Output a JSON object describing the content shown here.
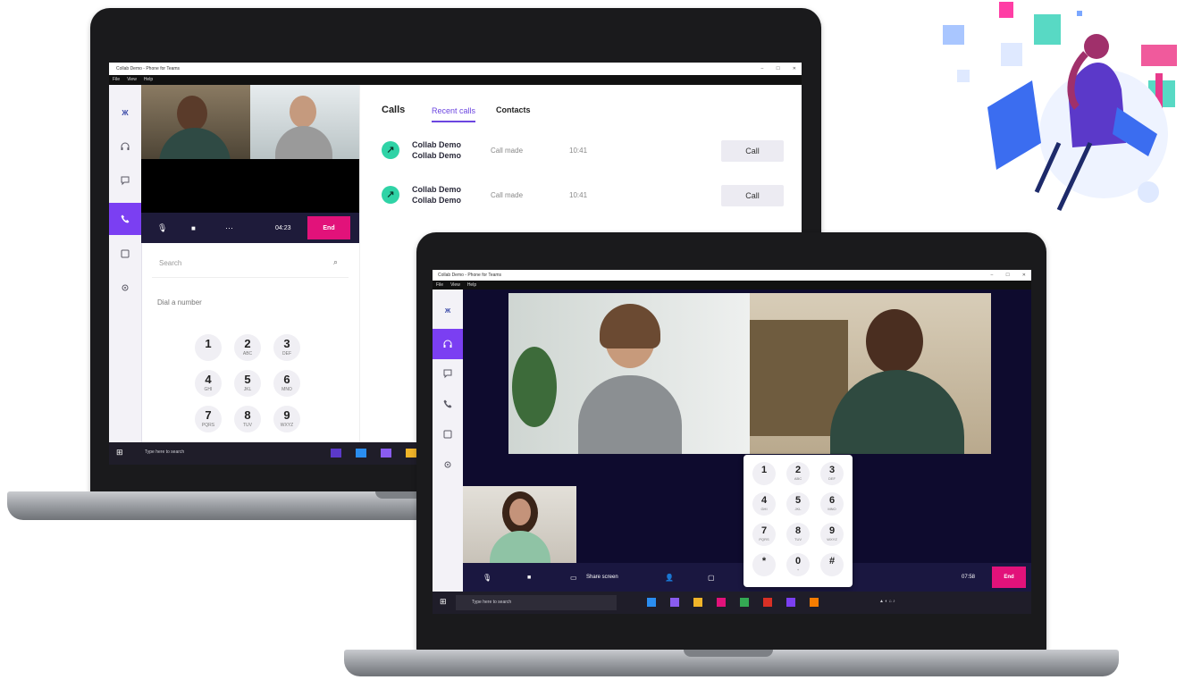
{
  "left_app": {
    "window_title": "Collab Demo - Phone for Teams",
    "menu": [
      "File",
      "View",
      "Help"
    ],
    "call": {
      "timer": "04:23",
      "end_label": "End"
    },
    "search_placeholder": "Search",
    "dial_placeholder": "Dial a number",
    "keypad": [
      {
        "digit": "1",
        "letters": ""
      },
      {
        "digit": "2",
        "letters": "ABC"
      },
      {
        "digit": "3",
        "letters": "DEF"
      },
      {
        "digit": "4",
        "letters": "GHI"
      },
      {
        "digit": "5",
        "letters": "JKL"
      },
      {
        "digit": "6",
        "letters": "MNO"
      },
      {
        "digit": "7",
        "letters": "PQRS"
      },
      {
        "digit": "8",
        "letters": "TUV"
      },
      {
        "digit": "9",
        "letters": "WXYZ"
      }
    ],
    "tabs": {
      "calls": "Calls",
      "recent": "Recent calls",
      "contacts": "Contacts"
    },
    "recent_calls": [
      {
        "name1": "Collab Demo",
        "name2": "Collab Demo",
        "status": "Call made",
        "duration": "10:41",
        "button": "Call"
      },
      {
        "name1": "Collab Demo",
        "name2": "Collab Demo",
        "status": "Call made",
        "duration": "10:41",
        "button": "Call"
      }
    ],
    "taskbar_search": "Type here to search"
  },
  "right_app": {
    "window_title": "Collab Demo - Phone for Teams",
    "menu": [
      "File",
      "View",
      "Help"
    ],
    "controls": {
      "share_label": "Share screen",
      "timer": "07:58",
      "end_label": "End"
    },
    "keypad": [
      {
        "digit": "1",
        "letters": ""
      },
      {
        "digit": "2",
        "letters": "ABC"
      },
      {
        "digit": "3",
        "letters": "DEF"
      },
      {
        "digit": "4",
        "letters": "GHI"
      },
      {
        "digit": "5",
        "letters": "JKL"
      },
      {
        "digit": "6",
        "letters": "MNO"
      },
      {
        "digit": "7",
        "letters": "PQRS"
      },
      {
        "digit": "8",
        "letters": "TUV"
      },
      {
        "digit": "9",
        "letters": "WXYZ"
      },
      {
        "digit": "*",
        "letters": ""
      },
      {
        "digit": "0",
        "letters": "+"
      },
      {
        "digit": "#",
        "letters": ""
      }
    ],
    "taskbar_search": "Type here to search"
  },
  "colors": {
    "accent": "#7b3ff2",
    "end_button": "#e2127a",
    "call_icon": "#2fd3a6",
    "call_bar": "#1e1b3a"
  }
}
